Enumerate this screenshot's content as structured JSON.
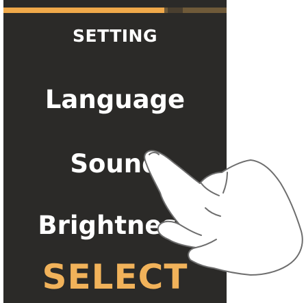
{
  "screen": {
    "title": "SETTING",
    "progress": 0.72,
    "menu": {
      "items": [
        {
          "label": "Language"
        },
        {
          "label": "Sound"
        },
        {
          "label": "Brightness"
        }
      ]
    },
    "action_label": "SELECT"
  },
  "colors": {
    "panel_bg": "#2b2a28",
    "accent": "#f1b25a",
    "progress_track": "#6f5a39",
    "text": "#ffffff"
  },
  "icons": {
    "hand": "pointing-hand-icon"
  }
}
